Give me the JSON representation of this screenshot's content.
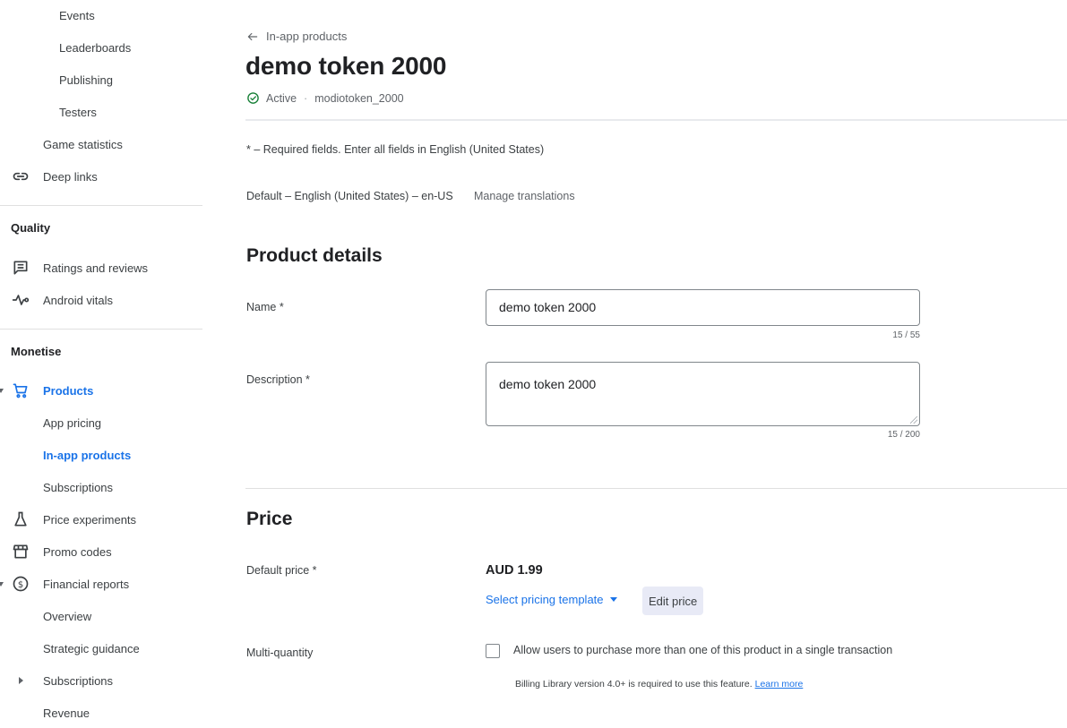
{
  "sidebar": {
    "items_top": [
      {
        "label": "Events"
      },
      {
        "label": "Leaderboards"
      },
      {
        "label": "Publishing"
      },
      {
        "label": "Testers"
      }
    ],
    "game_statistics": "Game statistics",
    "deep_links": "Deep links",
    "quality": {
      "title": "Quality",
      "ratings": "Ratings and reviews",
      "vitals": "Android vitals"
    },
    "monetise": {
      "title": "Monetise",
      "products": "Products",
      "app_pricing": "App pricing",
      "in_app_products": "In-app products",
      "subscriptions": "Subscriptions",
      "price_experiments": "Price experiments",
      "promo_codes": "Promo codes",
      "financial_reports": "Financial reports",
      "overview": "Overview",
      "strategic_guidance": "Strategic guidance",
      "fin_subscriptions": "Subscriptions",
      "revenue": "Revenue"
    },
    "active_color": "#1a73e8"
  },
  "header": {
    "back_label": "In-app products",
    "title": "demo token 2000",
    "status": "Active",
    "product_id": "modiotoken_2000",
    "status_color": "#188038"
  },
  "info": {
    "required_note": "* – Required fields. Enter all fields in English (United States)",
    "default_language": "Default – English (United States) – en-US",
    "manage_translations": "Manage translations"
  },
  "product_details": {
    "heading": "Product details",
    "name_label": "Name  *",
    "name_value": "demo token 2000",
    "name_counter": "15 / 55",
    "description_label": "Description  *",
    "description_value": "demo token 2000",
    "description_counter": "15 / 200"
  },
  "price": {
    "heading": "Price",
    "default_price_label": "Default price  *",
    "default_price_value": "AUD 1.99",
    "select_template": "Select pricing template",
    "edit_price": "Edit price",
    "multi_quantity_label": "Multi-quantity",
    "multi_quantity_checkbox": "Allow users to purchase more than one of this product in a single transaction",
    "multi_quantity_checked": false,
    "billing_note": "Billing Library version 4.0+ is required to use this feature.",
    "learn_more": "Learn more"
  }
}
